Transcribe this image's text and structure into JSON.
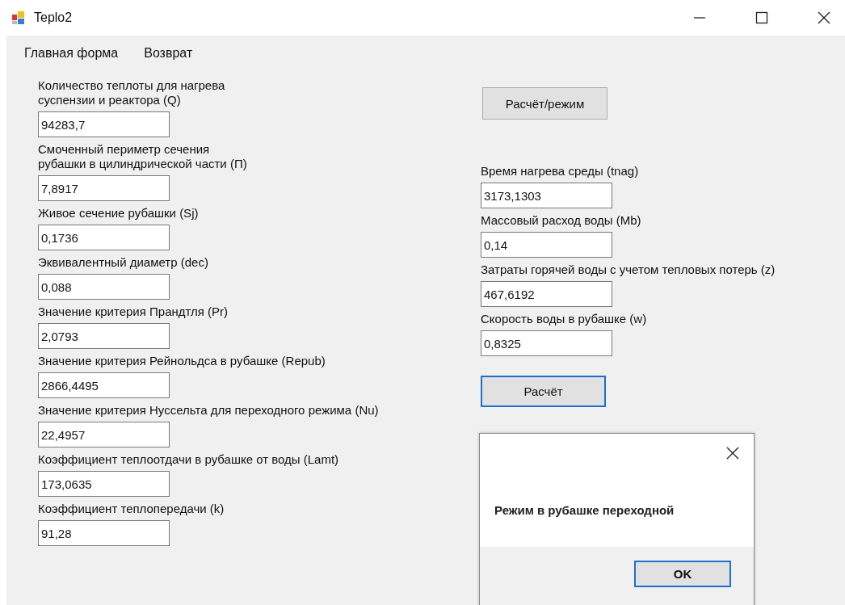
{
  "window": {
    "title": "Teplo2"
  },
  "menu": [
    {
      "label": "Главная форма"
    },
    {
      "label": "Возврат"
    }
  ],
  "left_fields": [
    {
      "label": "Количество теплоты для нагрева\nсуспензии и реактора (Q)",
      "value": "94283,7"
    },
    {
      "label": "Смоченный периметр сечения\nрубашки в цилиндрической части (П)",
      "value": "7,8917"
    },
    {
      "label": "Живое сечение рубашки (Sj)",
      "value": "0,1736"
    },
    {
      "label": "Эквивалентный диаметр (dec)",
      "value": "0,088"
    },
    {
      "label": "Значение критерия Прандтля (Pr)",
      "value": "2,0793"
    },
    {
      "label": "Значение критерия Рейнольдса в рубашке (Repub)",
      "value": "2866,4495"
    },
    {
      "label": "Значение критерия Нуссельта для переходного режима (Nu)",
      "value": "22,4957"
    },
    {
      "label": "Коэффициент теплоотдачи в рубашке от воды (Lamt)",
      "value": "173,0635"
    },
    {
      "label": "Коэффициент теплопередачи (k)",
      "value": "91,28"
    }
  ],
  "mode_button": {
    "label": "Расчёт/режим",
    "focused": false
  },
  "right_fields": [
    {
      "label": "Время нагрева среды (tnag)",
      "value": "3173,1303"
    },
    {
      "label": "Массовый расход воды (Mb)",
      "value": "0,14"
    },
    {
      "label": "Затраты горячей воды с учетом тепловых потерь (z)",
      "value": "467,6192"
    },
    {
      "label": "Скорость воды в рубашке (w)",
      "value": "0,8325"
    }
  ],
  "calc_button": {
    "label": "Расчёт",
    "focused": true
  },
  "dialog": {
    "message": "Режим в рубашке переходной",
    "ok_button": {
      "label": "OK",
      "focused": true
    }
  }
}
